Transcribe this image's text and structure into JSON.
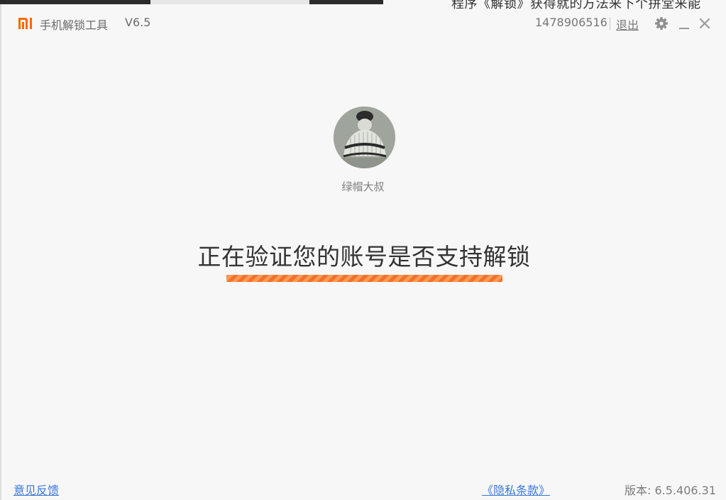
{
  "background": {
    "partial_text": "程序《解锁》获得就的方法来下个拼堂来能"
  },
  "titlebar": {
    "logo_text": "mi",
    "title": "手机解锁工具",
    "version": "V6.5",
    "account_id": "1478906516",
    "logout_label": "退出",
    "settings_icon": "gear-icon",
    "minimize_icon": "minimize-icon",
    "close_icon": "close-icon"
  },
  "user": {
    "avatar_icon": "avatar",
    "name": "绿帽大叔"
  },
  "status": {
    "heading": "正在验证您的账号是否支持解锁",
    "progress": 1.0
  },
  "footer": {
    "feedback_label": "意见反馈",
    "privacy_label": "《隐私条款》",
    "version_label": "版本: 6.5.406.31"
  },
  "colors": {
    "brand_orange": "#ff6700",
    "link_blue": "#3b78d8",
    "progress_orange": "#f57128",
    "window_bg": "#f7f7f7"
  }
}
